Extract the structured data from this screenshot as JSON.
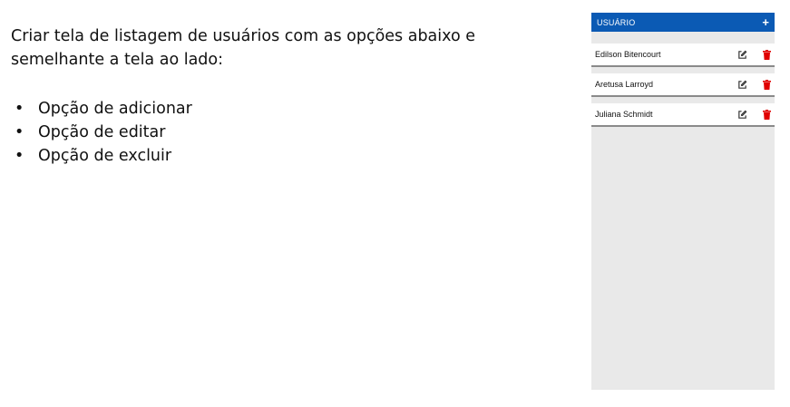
{
  "instructions": {
    "description_line1": "Criar tela de listagem de usuários com as opções abaixo e",
    "description_line2": "semelhante a tela ao lado:",
    "bullet_char": "•",
    "options": [
      "Opção de adicionar",
      "Opção de editar",
      "Opção de excluir"
    ]
  },
  "mockup": {
    "header_title": "USUÁRIO",
    "add_symbol": "+",
    "users": [
      {
        "name": "Edilson Bitencourt"
      },
      {
        "name": "Aretusa Larroyd"
      },
      {
        "name": "Juliana Schmidt"
      }
    ],
    "colors": {
      "header_bg": "#0b5ab4",
      "panel_bg": "#e9e9e9",
      "delete_icon": "#e00000",
      "edit_icon": "#333333"
    },
    "icons": {
      "add": "plus-icon",
      "edit": "edit-icon",
      "delete": "trash-icon"
    }
  }
}
